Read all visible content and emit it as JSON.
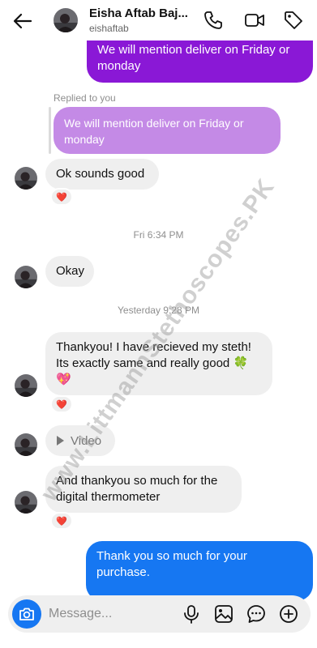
{
  "header": {
    "name": "Eisha Aftab Baj...",
    "username": "eishaftab"
  },
  "messages": {
    "out1": "We will mention deliver on Friday or monday",
    "replied_label": "Replied to you",
    "reply_quote": "We will mention deliver on Friday or monday",
    "in1": "Ok sounds good",
    "ts1": "Fri 6:34 PM",
    "in2": "Okay",
    "ts2": "Yesterday 9:28 PM",
    "in3": "Thankyou! I have recieved my steth! Its exactly same and really good 🍀 💖",
    "video_label": "Video",
    "in4": "And thankyou so much for the digital thermometer",
    "out2": "Thank you so much for your purchase."
  },
  "reactions": {
    "emoji": "❤️"
  },
  "composer": {
    "placeholder": "Message..."
  },
  "watermark": "www.LittmannStethoscopes.PK",
  "colors": {
    "purple_bubble": "#8a18d6",
    "reply_bubble": "#c48ae6",
    "blue_bubble": "#1677f2",
    "incoming_bubble": "#efefef"
  }
}
